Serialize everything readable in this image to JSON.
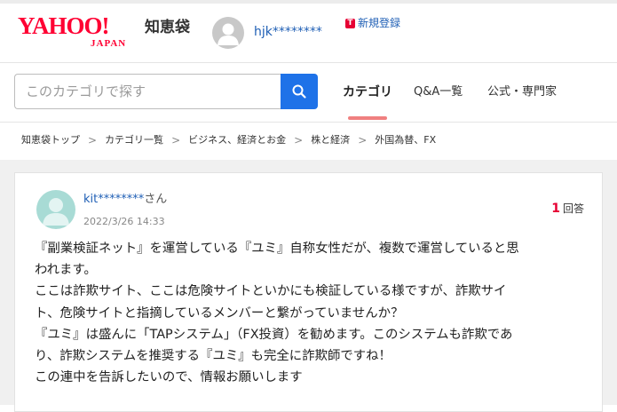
{
  "header": {
    "logo_main": "YAHOO!",
    "logo_sub": "JAPAN",
    "service_name": "知恵袋",
    "username": "hjk********",
    "register_badge": "T",
    "register_label": "新規登録"
  },
  "search": {
    "placeholder": "このカテゴリで探す"
  },
  "nav": {
    "tabs": [
      "カテゴリ",
      "Q&A一覧",
      "公式・専門家"
    ]
  },
  "breadcrumb": [
    "知恵袋トップ",
    "カテゴリ一覧",
    "ビジネス、経済とお金",
    "株と経済",
    "外国為替、FX"
  ],
  "question": {
    "user": "kit********",
    "user_suffix": "さん",
    "date": "2022/3/26 14:33",
    "answer_count": "1",
    "answer_label": "回答",
    "body_lines": [
      "『副業検証ネット』を運営している『ユミ』自称女性だが、複数で運営していると思",
      "われます。",
      "ここは詐欺サイト、ここは危険サイトといかにも検証している様ですが、詐欺サイ",
      "ト、危険サイトと指摘しているメンバーと繋がっていませんか？",
      "『ユミ』は盛んに「TAPシステム」（FX投資）を勧めます。このシステムも詐欺であ",
      "り、詐欺システムを推奨する『ユミ』も完全に詐欺師ですね！",
      "この連中を告訴したいので、情報お願いします"
    ]
  }
}
